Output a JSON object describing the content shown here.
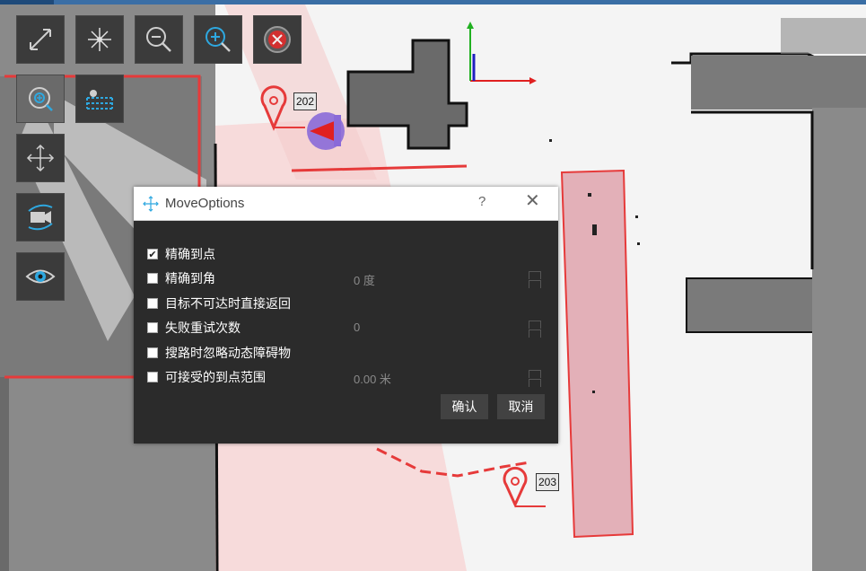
{
  "toolbar": {
    "items": [
      {
        "id": "fullscreen",
        "icon": "expand-icon"
      },
      {
        "id": "center",
        "icon": "crosshair-star-icon"
      },
      {
        "id": "zoom-out",
        "icon": "zoom-out-icon"
      },
      {
        "id": "zoom-in",
        "icon": "zoom-in-icon"
      },
      {
        "id": "stop",
        "icon": "stop-circle-icon"
      },
      {
        "id": "zoom-area",
        "icon": "zoom-target-icon"
      },
      {
        "id": "lidar",
        "icon": "lidar-scan-icon"
      },
      {
        "id": "move",
        "icon": "move-arrows-icon"
      },
      {
        "id": "camera",
        "icon": "camera-rotate-icon"
      },
      {
        "id": "view",
        "icon": "eye-icon"
      }
    ]
  },
  "map": {
    "markers": [
      {
        "label": "202"
      },
      {
        "label": "203"
      }
    ],
    "colors": {
      "path": "#e63a3a",
      "zone": "#e8b5bd",
      "robot": "#8a6ad8",
      "axis_x": "#e02020",
      "axis_y": "#20b020"
    }
  },
  "dialog": {
    "title": "MoveOptions",
    "help": "?",
    "close": "✕",
    "options": [
      {
        "label": "精确到点",
        "checked": true,
        "value": ""
      },
      {
        "label": "精确到角",
        "checked": false,
        "value": "0 度"
      },
      {
        "label": "目标不可达时直接返回",
        "checked": false,
        "value": ""
      },
      {
        "label": "失败重试次数",
        "checked": false,
        "value": "0"
      },
      {
        "label": "搜路时忽略动态障碍物",
        "checked": false,
        "value": ""
      },
      {
        "label": "可接受的到点范围",
        "checked": false,
        "value": "0.00 米"
      }
    ],
    "confirm": "确认",
    "cancel": "取消"
  }
}
